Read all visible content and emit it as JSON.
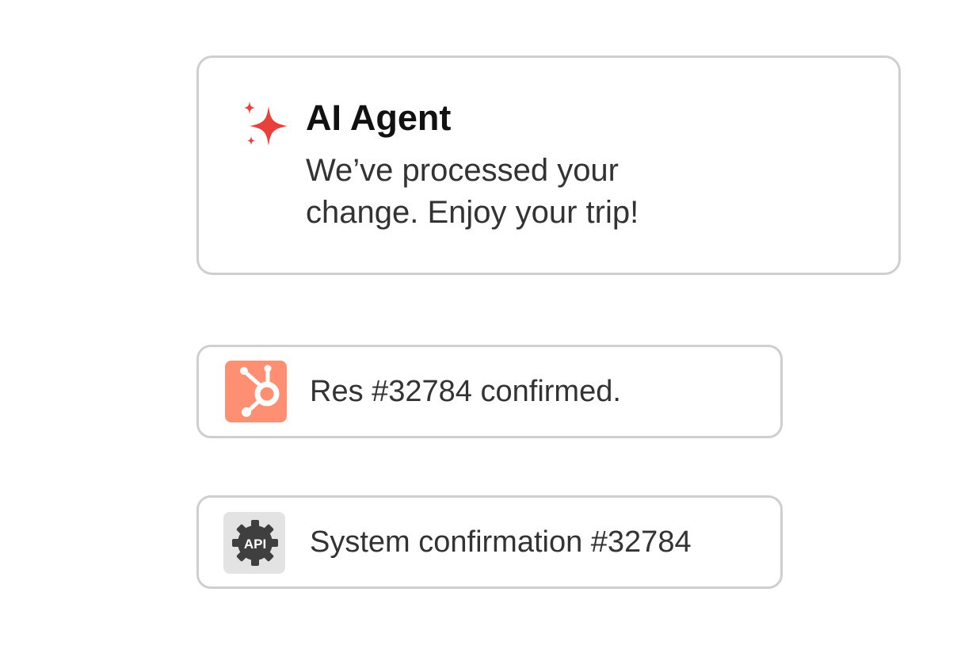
{
  "agent_card": {
    "icon": "sparkle-icon",
    "title": "AI Agent",
    "message": "We’ve processed your change. Enjoy your trip!",
    "accent_color": "#e8403a"
  },
  "confirmations": [
    {
      "icon": "hubspot-icon",
      "icon_bg": "#ff8f73",
      "text": "Res #32784 confirmed."
    },
    {
      "icon": "api-gear-icon",
      "icon_label": "API",
      "icon_bg": "#e3e3e3",
      "text": "System confirmation #32784"
    }
  ]
}
